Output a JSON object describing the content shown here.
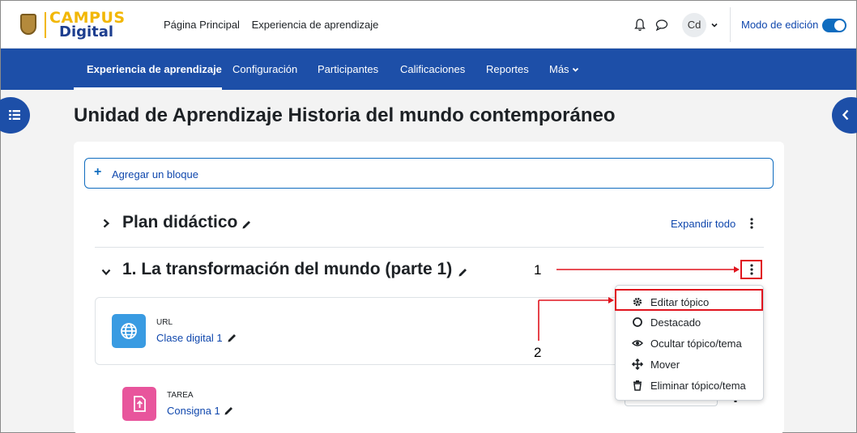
{
  "header": {
    "logo_top": "CAMPUS",
    "logo_bottom": "Digital",
    "nav": [
      "Página Principal",
      "Experiencia de aprendizaje"
    ],
    "avatar_initials": "Cd",
    "edit_mode_label": "Modo de edición",
    "edit_mode_on": true
  },
  "secondary_nav": {
    "items": [
      "Experiencia de aprendizaje",
      "Configuración",
      "Participantes",
      "Calificaciones",
      "Reportes",
      "Más"
    ],
    "active": "Experiencia de aprendizaje"
  },
  "page_title": "Unidad de Aprendizaje Historia del mundo contemporáneo",
  "add_block_label": "Agregar un bloque",
  "sections": [
    {
      "title": "Plan didáctico",
      "expanded": false,
      "action_link": "Expandir todo"
    },
    {
      "title": "1. La transformación del mundo (parte 1)",
      "expanded": true
    }
  ],
  "activities": [
    {
      "type": "URL",
      "name": "Clase digital 1",
      "icon": "globe-icon",
      "color": "#399be2"
    },
    {
      "type": "TAREA",
      "name": "Consigna 1",
      "icon": "assignment-upload-icon",
      "color": "#f7634d"
    }
  ],
  "context_menu": {
    "items": [
      {
        "label": "Editar tópico",
        "icon": "gear-icon"
      },
      {
        "label": "Destacado",
        "icon": "circle-icon"
      },
      {
        "label": "Ocultar tópico/tema",
        "icon": "eye-icon"
      },
      {
        "label": "Mover",
        "icon": "move-arrows-icon"
      },
      {
        "label": "Eliminar tópico/tema",
        "icon": "trash-icon"
      }
    ]
  },
  "annotations": {
    "step1": "1",
    "step2": "2",
    "color": "#e0141e"
  },
  "colors": {
    "brand_blue": "#1d4fa8",
    "link_blue": "#0f47ad",
    "accent_yellow": "#f2b705"
  }
}
